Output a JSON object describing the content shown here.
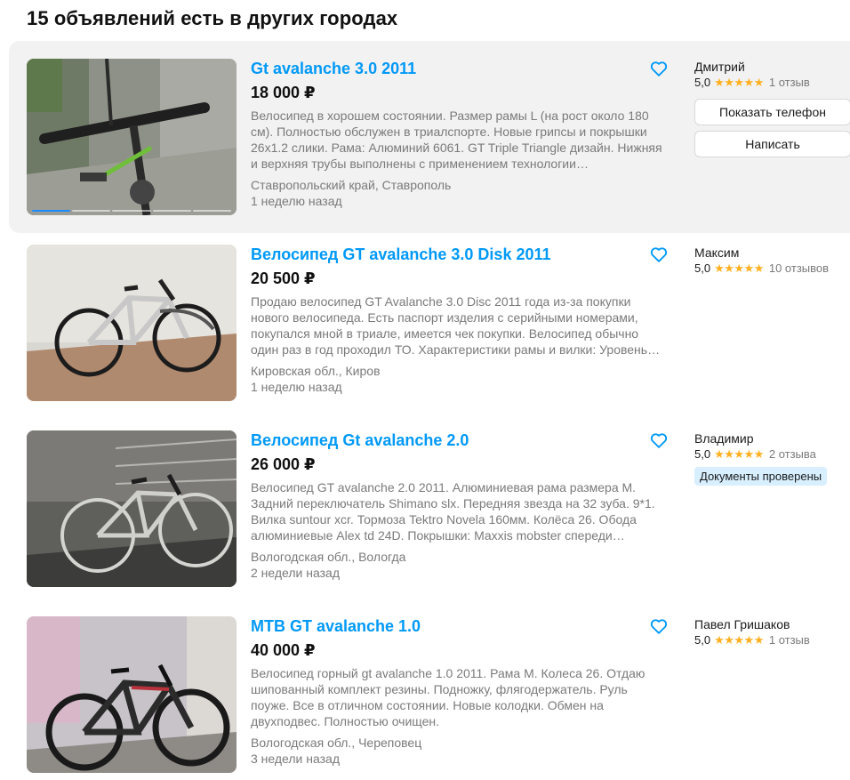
{
  "page_title": "15 объявлений есть в других городах",
  "colors": {
    "link": "#0099f7",
    "star": "#ffb021",
    "highlight_bg": "#f2f2f2",
    "badge_bg": "#d7efff"
  },
  "listings": [
    {
      "title": "Gt avalanche 3.0 2011",
      "price": "18 000 ₽",
      "description": "Велосипед в хорошем состоянии. Размер рамы L (на рост около 180 см). Полностью обслужен в триалспорте. Новые грипсы и покрышки 26х1.2 слики. Рама: Алюминий 6061. GT Triple Triangle дизайн. Нижняя и верхняя трубы выполнены с применением технологии…",
      "location": "Ставропольский край, Ставрополь",
      "date": "1 неделю назад",
      "favorite_icon": "heart-outline-icon",
      "seller": {
        "name": "Дмитрий",
        "rating": "5,0",
        "stars": "★★★★★",
        "reviews": "1 отзыв",
        "show_phone_label": "Показать телефон",
        "write_label": "Написать"
      }
    },
    {
      "title": "Велосипед GT avalanche 3.0 Disk 2011",
      "price": "20 500 ₽",
      "description": "Продаю велосипед GT Avalanche 3.0 Disc 2011 года из-за покупки нового велосипеда. Есть паспорт изделия с серийными номерами, покупался мной в триале, имеется чек покупки. Велосипед обычно один раз в год проходил ТО. Характеристики рамы и вилки: Уровень…",
      "location": "Кировская обл., Киров",
      "date": "1 неделю назад",
      "favorite_icon": "heart-outline-icon",
      "seller": {
        "name": "Максим",
        "rating": "5,0",
        "stars": "★★★★★",
        "reviews": "10 отзывов"
      }
    },
    {
      "title": "Велосипед Gt avalanche 2.0",
      "price": "26 000 ₽",
      "description": "Велосипед GT avalanche 2.0 2011. Алюминиевая рама размера M. Задний переключатель Shimano slx. Передняя звезда на 32 зуба. 9*1. Вилка suntour xcr. Тормоза Tektro Novela 160мм. Колёса 26. Обода алюминиевые Alex td 24D. Покрышки: Maxxis mobster спереди…",
      "location": "Вологодская обл., Вологда",
      "date": "2 недели назад",
      "favorite_icon": "heart-outline-icon",
      "seller": {
        "name": "Владимир",
        "rating": "5,0",
        "stars": "★★★★★",
        "reviews": "2 отзыва",
        "badge": "Документы проверены"
      }
    },
    {
      "title": "MTB GT avalanche 1.0",
      "price": "40 000 ₽",
      "description": "Велосипед горный gt avalanche 1.0 2011. Рама M. Колеса 26. Отдаю шипованный комплект резины. Подножку, флягодержатель. Руль поуже. Все в отличном состоянии. Новые колодки. Обмен на двухподвес. Полностью очищен.",
      "location": "Вологодская обл., Череповец",
      "date": "3 недели назад",
      "favorite_icon": "heart-outline-icon",
      "seller": {
        "name": "Павел Гришаков",
        "rating": "5,0",
        "stars": "★★★★★",
        "reviews": "1 отзыв"
      }
    }
  ]
}
